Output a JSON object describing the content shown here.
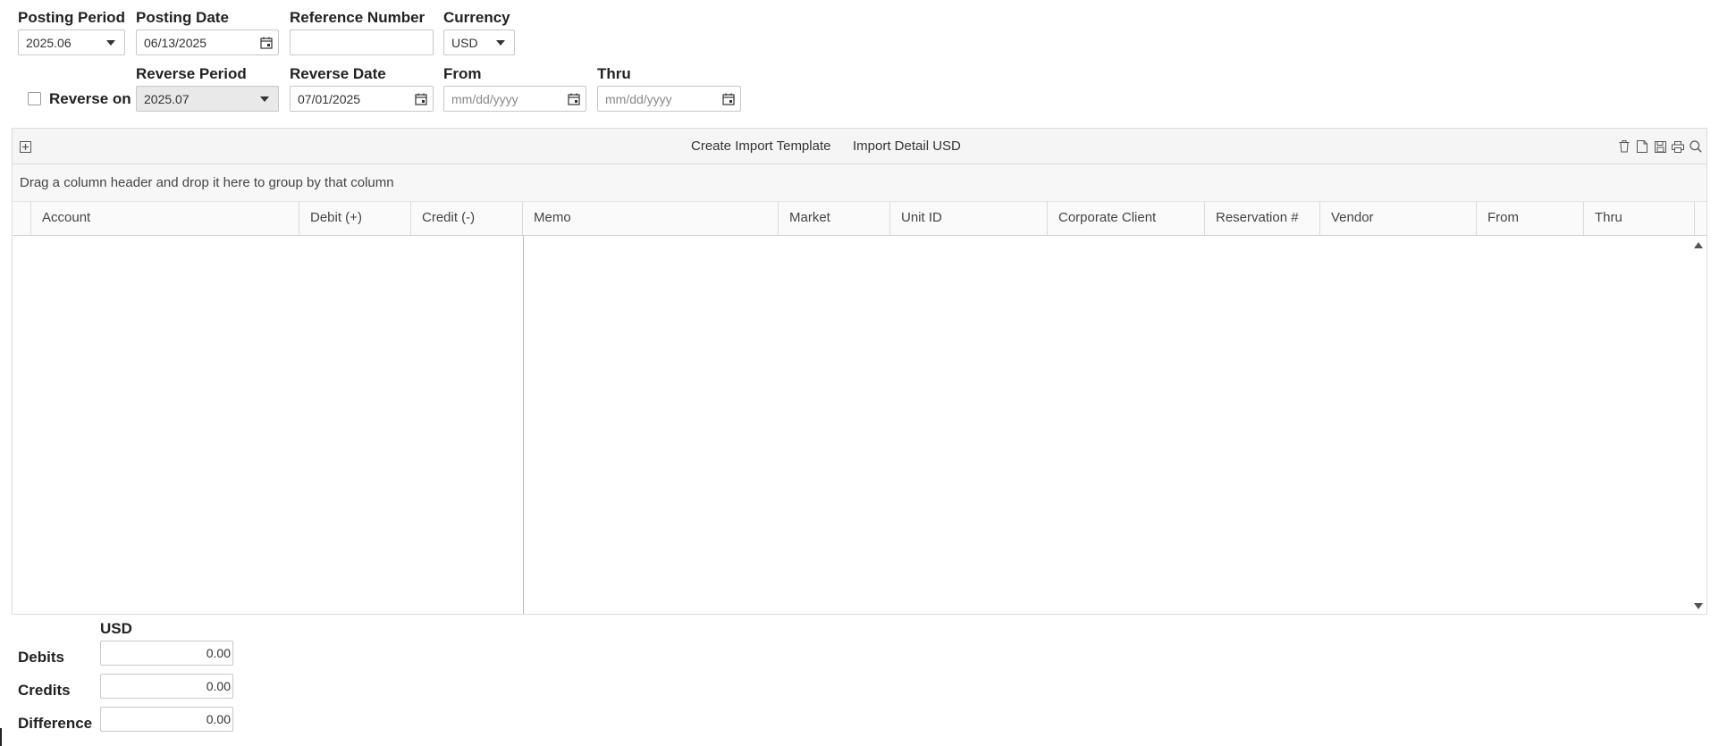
{
  "header_fields": {
    "posting_period": {
      "label": "Posting Period",
      "value": "2025.06"
    },
    "posting_date": {
      "label": "Posting Date",
      "value": "06/13/2025"
    },
    "reference_number": {
      "label": "Reference Number",
      "value": ""
    },
    "currency": {
      "label": "Currency",
      "value": "USD"
    },
    "reverse_on": {
      "label": "Reverse on",
      "checked": false
    },
    "reverse_period": {
      "label": "Reverse Period",
      "value": "2025.07"
    },
    "reverse_date": {
      "label": "Reverse Date",
      "value": "07/01/2025"
    },
    "from": {
      "label": "From",
      "placeholder": "mm/dd/yyyy"
    },
    "thru": {
      "label": "Thru",
      "placeholder": "mm/dd/yyyy"
    }
  },
  "toolbar": {
    "create_import_template": "Create Import Template",
    "import_detail": "Import Detail USD",
    "icons": [
      "expand-icon",
      "delete-icon",
      "document-icon",
      "save-icon",
      "print-icon",
      "search-icon"
    ]
  },
  "grid": {
    "group_hint": "Drag a column header and drop it here to group by that column",
    "columns": [
      "Account",
      "Debit (+)",
      "Credit (-)",
      "Memo",
      "Market",
      "Unit ID",
      "Corporate Client",
      "Reservation #",
      "Vendor",
      "From",
      "Thru"
    ],
    "rows": []
  },
  "totals": {
    "currency_header": "USD",
    "debits": {
      "label": "Debits",
      "value": "0.00"
    },
    "credits": {
      "label": "Credits",
      "value": "0.00"
    },
    "difference": {
      "label": "Difference",
      "value": "0.00"
    }
  },
  "colors": {
    "toolbar_bg": "#f5f5f5",
    "border": "#dcdcdc",
    "disabled_bg": "#e9e9e9"
  }
}
